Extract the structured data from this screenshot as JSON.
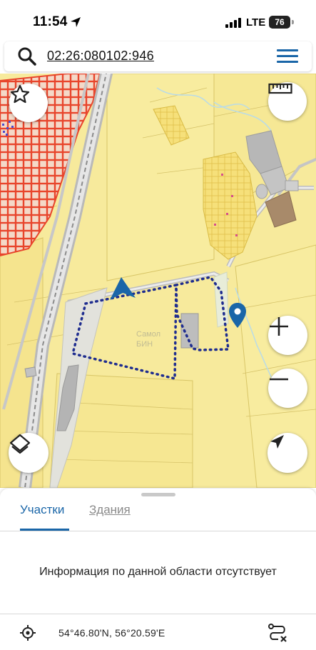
{
  "status_bar": {
    "time": "11:54",
    "network": "LTE",
    "battery": "76"
  },
  "search": {
    "query": "02:26:080102:946"
  },
  "map": {
    "watermark_line1": "Самол",
    "watermark_line2": "БИН"
  },
  "bottom_sheet": {
    "tabs": [
      {
        "label": "Участки",
        "active": true
      },
      {
        "label": "Здания",
        "active": false
      }
    ],
    "info_message": "Информация по данной области отсутствует",
    "coordinates": "54°46.80'N, 56°20.59'E"
  },
  "colors": {
    "accent": "#1a66a8",
    "map_background": "#f7ea9c",
    "parcel_outline": "#1f2d8f",
    "red_parcels": "#e8452c"
  }
}
